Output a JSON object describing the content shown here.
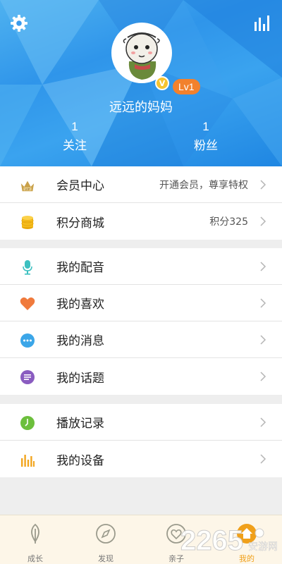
{
  "header": {
    "nickname": "远远的妈妈",
    "level": "Lv1",
    "vip_mark": "V",
    "stats": [
      {
        "count": "1",
        "label": "关注"
      },
      {
        "count": "1",
        "label": "粉丝"
      }
    ]
  },
  "groups": [
    [
      {
        "label": "会员中心",
        "value": "开通会员，尊享特权",
        "icon": "crown-vip-icon"
      },
      {
        "label": "积分商城",
        "value": "积分325",
        "icon": "coin-stack-icon"
      }
    ],
    [
      {
        "label": "我的配音",
        "icon": "microphone-icon"
      },
      {
        "label": "我的喜欢",
        "icon": "heart-icon"
      },
      {
        "label": "我的消息",
        "icon": "message-icon"
      },
      {
        "label": "我的话题",
        "icon": "topic-icon"
      }
    ],
    [
      {
        "label": "播放记录",
        "icon": "clock-icon"
      },
      {
        "label": "我的设备",
        "icon": "equalizer-icon"
      }
    ]
  ],
  "tabs": [
    {
      "label": "成长",
      "icon": "leaf-icon"
    },
    {
      "label": "发现",
      "icon": "compass-icon"
    },
    {
      "label": "亲子",
      "icon": "hearts-icon"
    },
    {
      "label": "我的",
      "icon": "home-icon",
      "active": true
    }
  ],
  "watermark": {
    "text": "2265",
    "suffix": "安游网"
  },
  "colors": {
    "header_blue": "#2f95ea",
    "level_orange": "#f2812d",
    "vip_gold": "#f6c431",
    "tab_active": "#f0a01a",
    "tabbar_bg": "#fdf6e8"
  }
}
